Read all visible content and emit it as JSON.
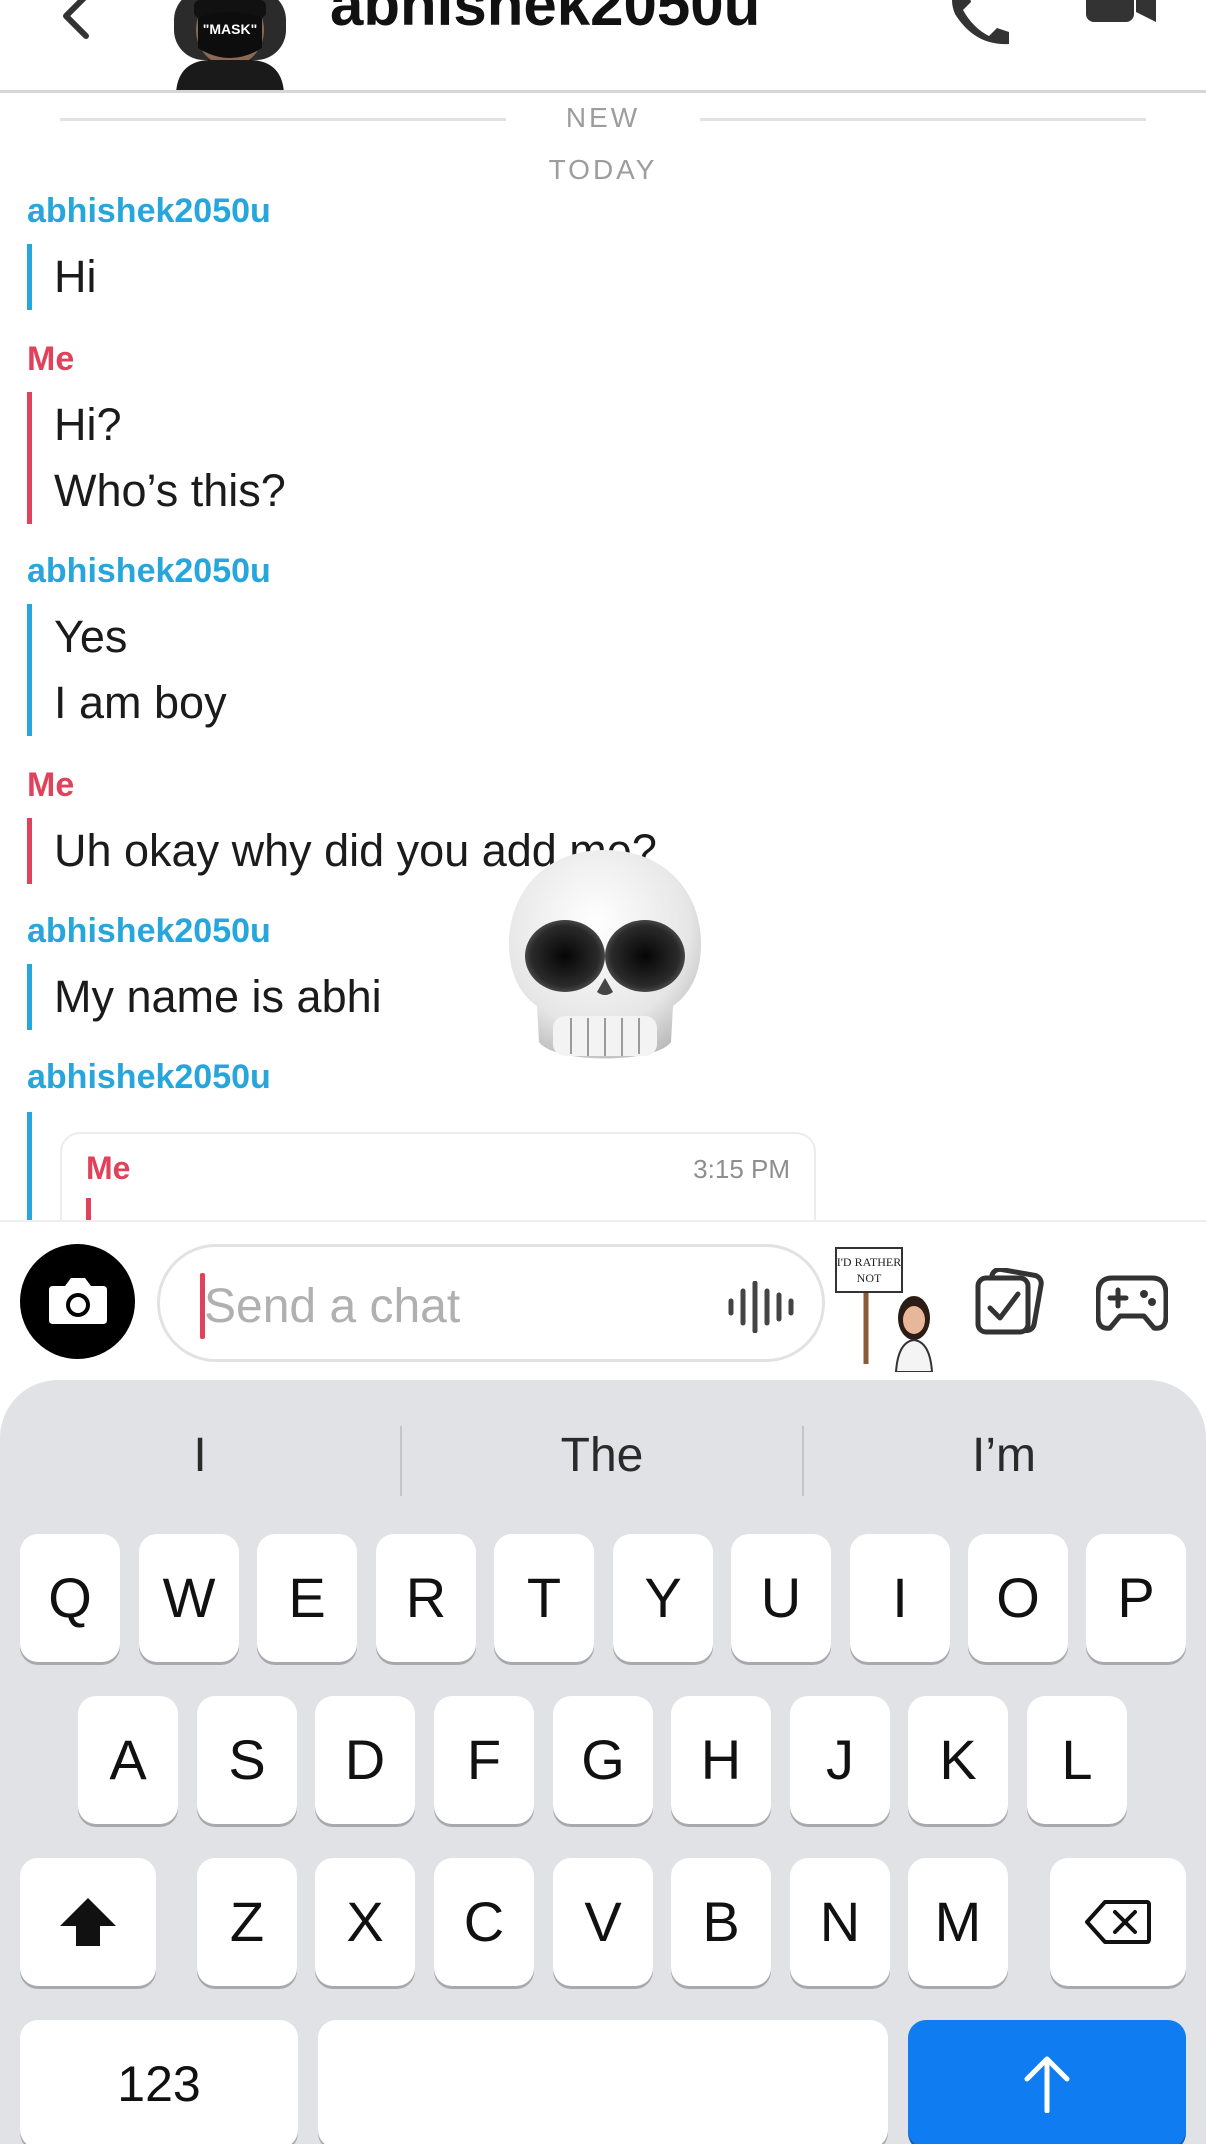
{
  "header": {
    "title": "abhishek2050u",
    "avatar_text": "\"MASK\""
  },
  "chat": {
    "separator_new": "NEW",
    "separator_today": "TODAY",
    "groups": [
      {
        "sender": "abhishek2050u",
        "lines": [
          "Hi"
        ]
      },
      {
        "sender": "Me",
        "lines": [
          "Hi?",
          "Who’s this?"
        ]
      },
      {
        "sender": "abhishek2050u",
        "lines": [
          "Yes",
          "I am boy"
        ]
      },
      {
        "sender": "Me",
        "lines": [
          "Uh okay why did you add me?"
        ]
      },
      {
        "sender": "abhishek2050u",
        "lines": [
          "My name is abhi"
        ]
      },
      {
        "sender": "abhishek2050u",
        "lines": []
      }
    ],
    "reaction_emoji": "skull",
    "quoted": {
      "sender": "Me",
      "time": "3:15 PM"
    }
  },
  "input": {
    "placeholder": "Send a chat",
    "sticker_text": "I'D RATHER NOT"
  },
  "keyboard": {
    "suggestions": [
      "I",
      "The",
      "I’m"
    ],
    "row1": [
      "Q",
      "W",
      "E",
      "R",
      "T",
      "Y",
      "U",
      "I",
      "O",
      "P"
    ],
    "row2": [
      "A",
      "S",
      "D",
      "F",
      "G",
      "H",
      "J",
      "K",
      "L"
    ],
    "row3": [
      "Z",
      "X",
      "C",
      "V",
      "B",
      "N",
      "M"
    ],
    "numbers_label": "123"
  },
  "colors": {
    "other_sender": "#27a6dc",
    "me_sender": "#e0415b",
    "send_key": "#0f7cf1"
  }
}
